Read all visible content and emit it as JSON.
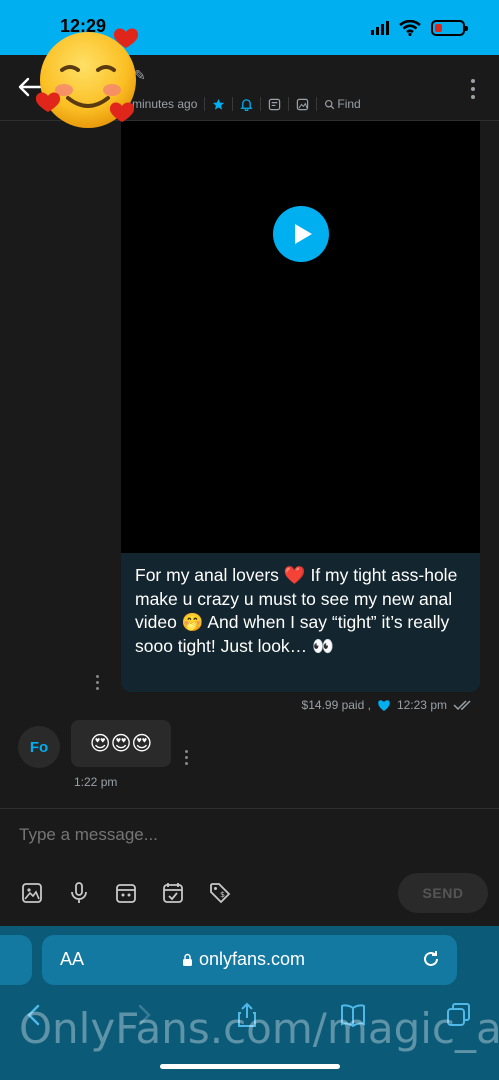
{
  "status_bar": {
    "time": "12:29",
    "battery_color": "#e0261b"
  },
  "header": {
    "subtitle_time": "minutes ago",
    "find_label": "Find",
    "icons": [
      "star-icon",
      "bell-icon",
      "note-icon",
      "image-icon",
      "search-icon"
    ]
  },
  "sticker": {
    "emoji": "☺️",
    "hearts": "❤️"
  },
  "outgoing_message": {
    "text": "For my anal lovers ❤️ If my tight ass-hole make u crazy u must to see my new anal video 🤭 And when I say “tight” it’s really sooo tight! Just look… 👀",
    "price": "$14.99 paid ,",
    "time": "12:23 pm"
  },
  "incoming_message": {
    "avatar_initials": "Fo",
    "emojis": "😍😍😍",
    "time": "1:22 pm"
  },
  "composer": {
    "placeholder": "Type a message...",
    "send_label": "SEND"
  },
  "safari": {
    "aa_label": "AA",
    "url": "onlyfans.com"
  },
  "watermark": "OnlyFans.com/magic_alice",
  "colors": {
    "accent": "#00aff0",
    "background": "#1a1a1a",
    "bubble_out": "#13262f"
  }
}
